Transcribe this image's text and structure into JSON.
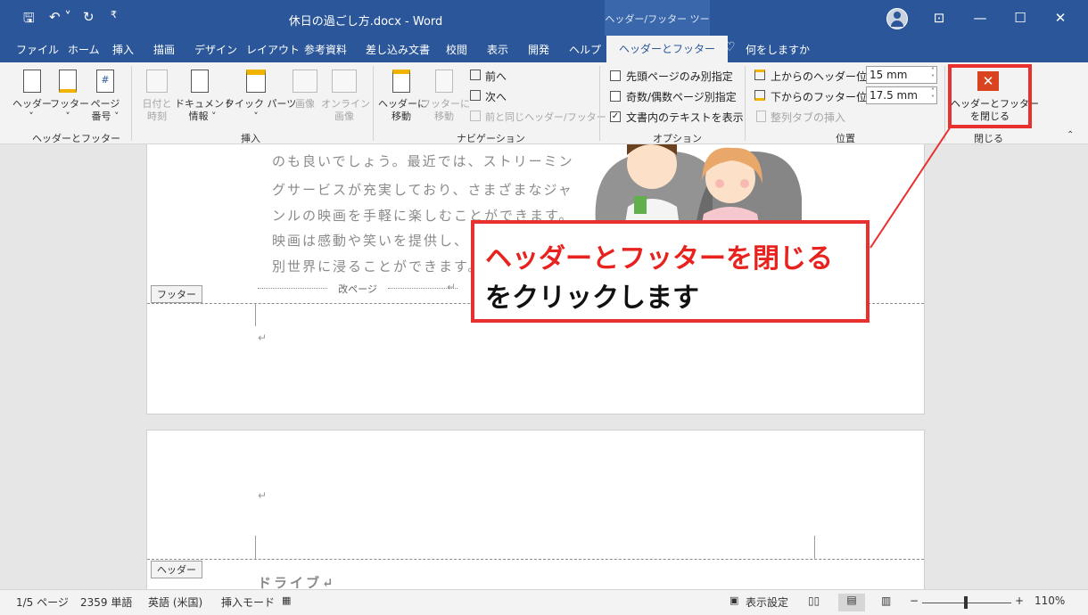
{
  "titlebar": {
    "doc_title": "休日の過ごし方.docx - Word",
    "context_tab": "ヘッダー/フッター ツール",
    "qa_save": "🖫",
    "qa_undo": "↶ ˅",
    "qa_redo": "↻",
    "qa_more": "₹",
    "ribbon_display": "⊡",
    "minimize": "—",
    "maximize": "☐",
    "close": "✕"
  },
  "tabs": [
    "ファイル",
    "ホーム",
    "挿入",
    "描画",
    "デザイン",
    "レイアウト",
    "参考資料",
    "差し込み文書",
    "校閲",
    "表示",
    "開発",
    "ヘルプ",
    "ヘッダーとフッター",
    "何をしますか"
  ],
  "ribbon": {
    "groups": {
      "header_footer": "ヘッダーとフッター",
      "insert": "挿入",
      "navigation": "ナビゲーション",
      "options": "オプション",
      "position": "位置",
      "close": "閉じる"
    },
    "header_btn": "ヘッダー",
    "footer_btn": "フッター",
    "page_num_l1": "ページ",
    "page_num_l2": "番号 ˅",
    "date_l1": "日付と",
    "date_l2": "時刻",
    "docinfo_l1": "ドキュメント",
    "docinfo_l2": "情報 ˅",
    "quickparts": "クイック パーツ",
    "picture": "画像",
    "online_l1": "オンライン",
    "online_l2": "画像",
    "goto_header_l1": "ヘッダーに",
    "goto_header_l2": "移動",
    "goto_footer_l1": "フッターに",
    "goto_footer_l2": "移動",
    "prev": "前へ",
    "next": "次へ",
    "link_prev": "前と同じヘッダー/フッター",
    "opt_first": "先頭ページのみ別指定",
    "opt_oddeven": "奇数/偶数ページ別指定",
    "opt_showtext": "文書内のテキストを表示",
    "header_pos_label": "上からのヘッダー位置:",
    "header_pos_value": "15 mm",
    "footer_pos_label": "下からのフッター位置:",
    "footer_pos_value": "17.5 mm",
    "align_tab": "整列タブの挿入",
    "close_l1": "ヘッダーとフッター",
    "close_l2": "を閉じる"
  },
  "document": {
    "lines": [
      "のも良いでしょう。最近では、ストリーミン",
      "グサービスが充実しており、さまざまなジャ",
      "ンルの映画を手軽に楽しむことができます。",
      "映画は感動や笑いを提供し、日",
      "別世界に浸ることができます。"
    ],
    "footer_tag": "フッター",
    "header_tag": "ヘッダー",
    "page_break": "改ページ",
    "next_heading": "ドライブ↵",
    "para_mark": "↵"
  },
  "callout": {
    "line1": "ヘッダーとフッターを閉じる",
    "line2": "をクリックします"
  },
  "statusbar": {
    "page": "1/5 ページ",
    "words": "2359 単語",
    "lang": "英語 (米国)",
    "mode": "挿入モード",
    "display_settings": "表示設定",
    "zoom": "110%"
  },
  "colors": {
    "brand": "#2b579a",
    "highlight": "#e8302f"
  }
}
